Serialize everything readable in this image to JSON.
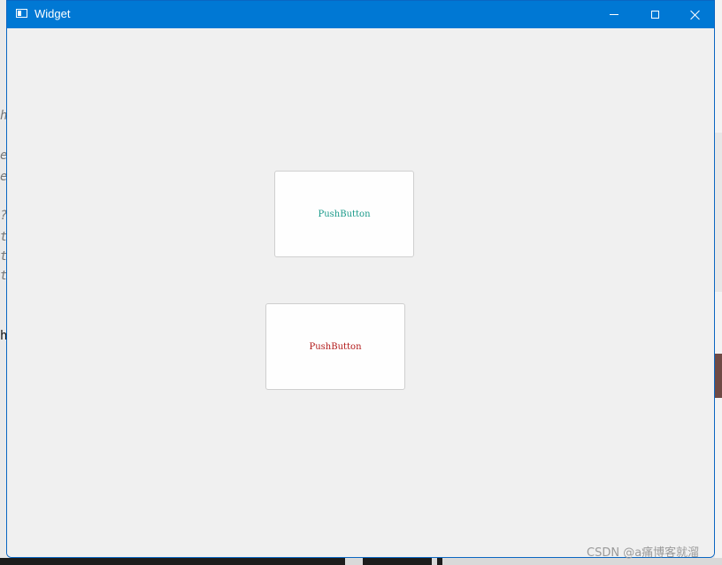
{
  "window": {
    "title": "Widget",
    "controls": {
      "minimize": "minimize",
      "maximize": "maximize",
      "close": "close"
    }
  },
  "buttons": [
    {
      "label": "PushButton",
      "color": "#1a9a8a"
    },
    {
      "label": "PushButton",
      "color": "#b21a1a"
    }
  ],
  "watermark": "CSDN @a痛博客就溜",
  "colors": {
    "titlebar": "#0078d4",
    "client_bg": "#f0f0f0"
  }
}
